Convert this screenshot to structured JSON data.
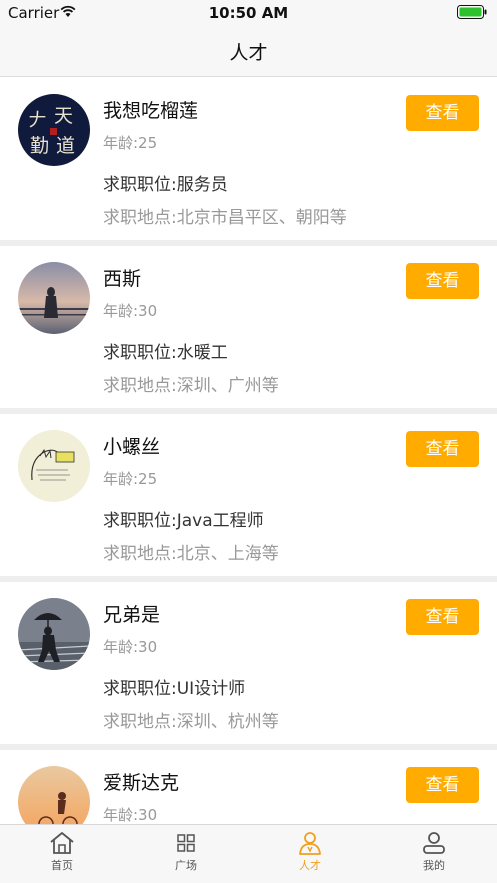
{
  "status_bar": {
    "carrier": "Carrier",
    "time": "10:50 AM"
  },
  "nav": {
    "title": "人才"
  },
  "candidates": [
    {
      "name": "我想吃榴莲",
      "age": "年龄:25",
      "position": "求职职位:服务员",
      "location": "求职地点:北京市昌平区、朝阳等",
      "button": "查看",
      "avatar": "calligraphy-avatar"
    },
    {
      "name": "西斯",
      "age": "年龄:30",
      "position": "求职职位:水暖工",
      "location": "求职地点:深圳、广州等",
      "button": "查看",
      "avatar": "sunset-pier-avatar"
    },
    {
      "name": "小螺丝",
      "age": "年龄:25",
      "position": "求职职位:Java工程师",
      "location": "求职地点:北京、上海等",
      "button": "查看",
      "avatar": "doodle-avatar"
    },
    {
      "name": "兄弟是",
      "age": "年龄:30",
      "position": "求职职位:UI设计师",
      "location": "求职地点:深圳、杭州等",
      "button": "查看",
      "avatar": "umbrella-street-avatar"
    },
    {
      "name": "爱斯达克",
      "age": "年龄:30",
      "position": "",
      "location": "",
      "button": "查看",
      "avatar": "cyclist-sunset-avatar"
    }
  ],
  "tabs": [
    {
      "label": "首页",
      "icon": "home-icon",
      "active": false
    },
    {
      "label": "广场",
      "icon": "grid-icon",
      "active": false
    },
    {
      "label": "人才",
      "icon": "talent-icon",
      "active": true
    },
    {
      "label": "我的",
      "icon": "profile-icon",
      "active": false
    }
  ],
  "colors": {
    "accent": "#ffab00",
    "active_tab": "#f0a020",
    "separator": "#eeeeee"
  }
}
